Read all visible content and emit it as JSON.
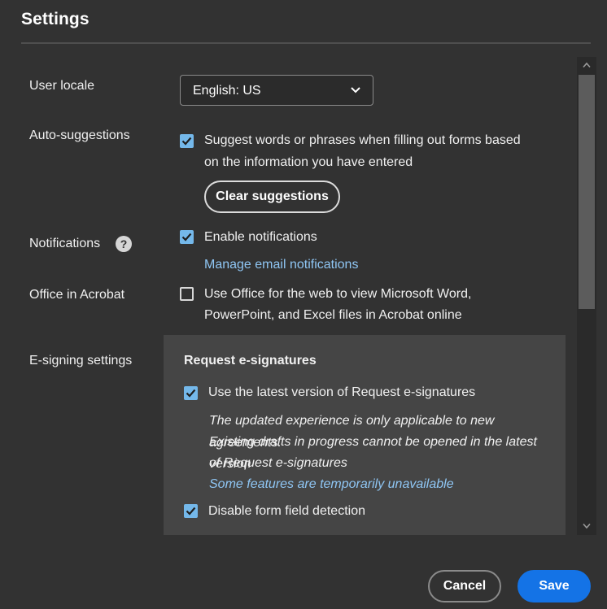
{
  "dialog": {
    "title": "Settings"
  },
  "user_locale": {
    "label": "User locale",
    "selected": "English: US"
  },
  "auto_suggestions": {
    "label": "Auto-suggestions",
    "checkbox_checked": true,
    "line1": "Suggest words or phrases when filling out forms based",
    "line2": "on the information you have entered",
    "clear_button": "Clear suggestions"
  },
  "notifications": {
    "label": "Notifications",
    "help_icon": "question-circle-icon",
    "enable_checked": true,
    "enable_label": "Enable notifications",
    "manage_link": "Manage email notifications"
  },
  "office": {
    "label": "Office in Acrobat",
    "checked": false,
    "line1": "Use Office for the web to view Microsoft Word,",
    "line2": "PowerPoint, and Excel files in Acrobat online"
  },
  "esigning": {
    "label": "E-signing settings",
    "section_title": "Request e-signatures",
    "latest_checked": true,
    "latest_label": "Use the latest version of Request e-signatures",
    "note_line1": "The updated experience is only applicable to new agreements.",
    "note_line2": "Existing drafts in progress cannot be opened in the latest version",
    "note_line3": "of Request e-signatures",
    "features_link": "Some features are temporarily unavailable",
    "disable_detection_checked": true,
    "disable_detection_label": "Disable form field detection"
  },
  "footer": {
    "cancel": "Cancel",
    "save": "Save"
  },
  "colors": {
    "accent": "#1473e6",
    "checkbox": "#74b8ea",
    "link": "#8fc6f4",
    "background": "#323232"
  }
}
